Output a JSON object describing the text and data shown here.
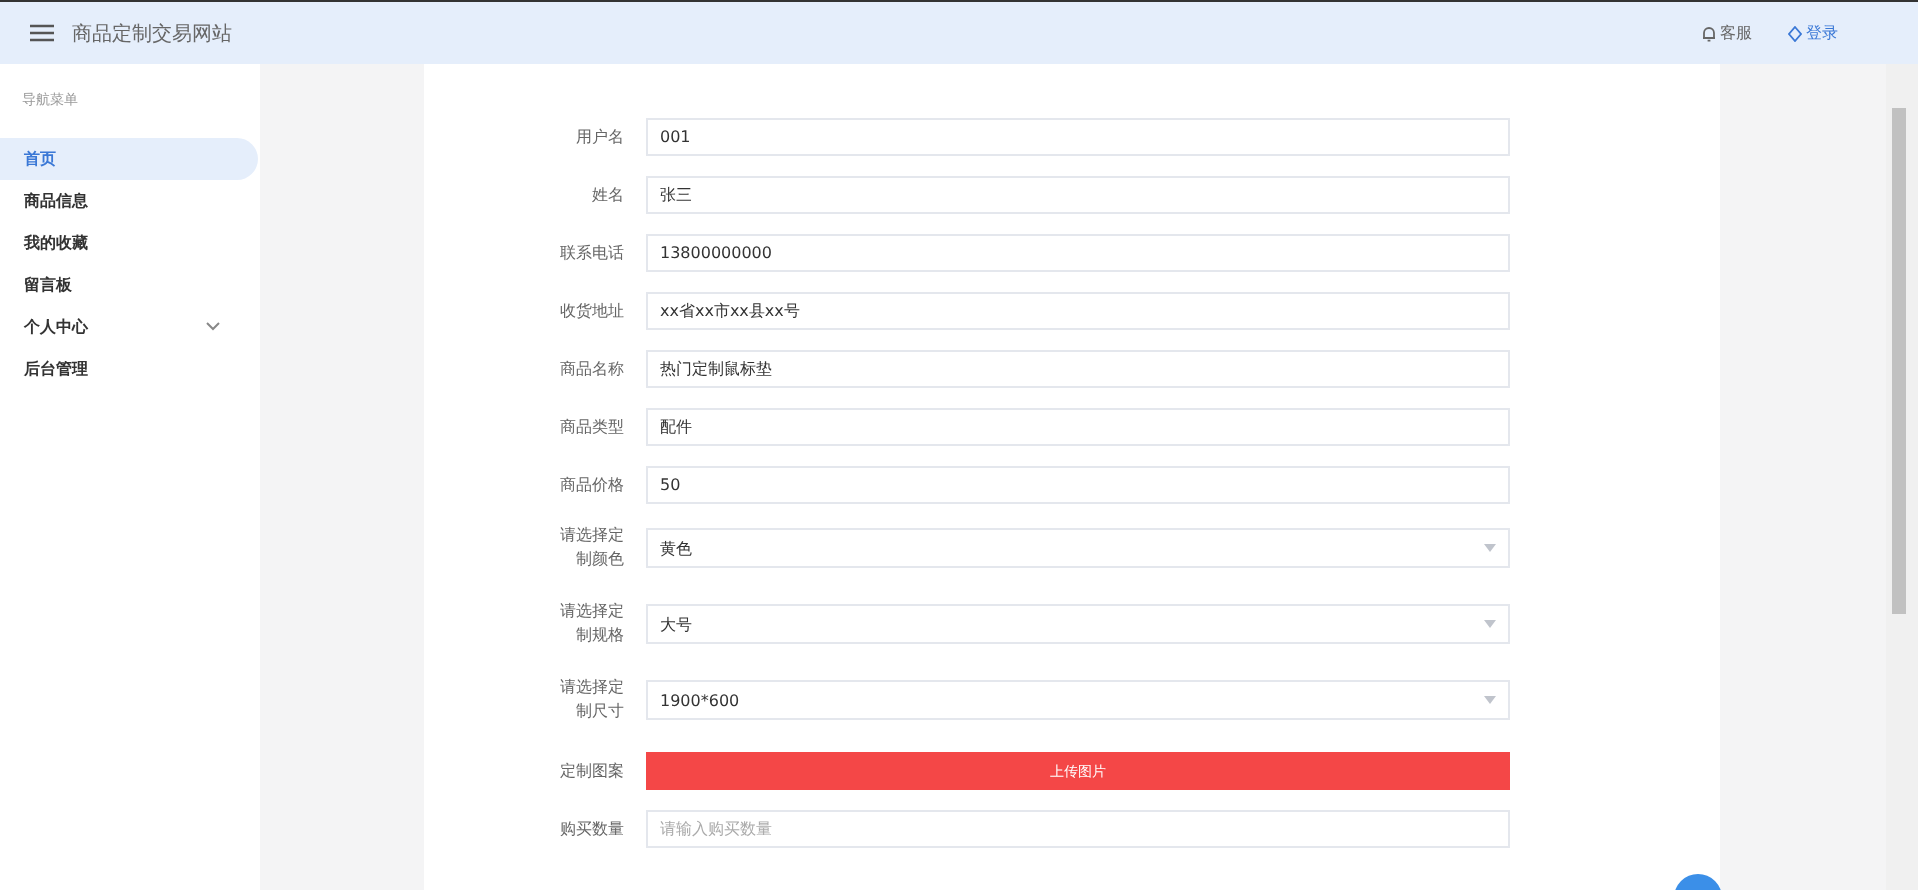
{
  "header": {
    "title": "商品定制交易网站",
    "links": [
      {
        "label": "客服",
        "kind": "service"
      },
      {
        "label": "登录",
        "kind": "login"
      }
    ]
  },
  "sidebar": {
    "heading": "导航菜单",
    "items": [
      {
        "label": "首页",
        "selected": true
      },
      {
        "label": "商品信息",
        "selected": false
      },
      {
        "label": "我的收藏",
        "selected": false
      },
      {
        "label": "留言板",
        "selected": false
      },
      {
        "label": "个人中心",
        "selected": false,
        "expanded": false
      },
      {
        "label": "后台管理",
        "selected": false
      }
    ]
  },
  "form": {
    "fields": [
      {
        "kind": "text",
        "label": "用户名",
        "value": "001"
      },
      {
        "kind": "text",
        "label": "姓名",
        "value": "张三"
      },
      {
        "kind": "text",
        "label": "联系电话",
        "value": "13800000000"
      },
      {
        "kind": "text",
        "label": "收货地址",
        "value": "xx省xx市xx县xx号"
      },
      {
        "kind": "text",
        "label": "商品名称",
        "value": "热门定制鼠标垫"
      },
      {
        "kind": "text",
        "label": "商品类型",
        "value": "配件"
      },
      {
        "kind": "text",
        "label": "商品价格",
        "value": "50"
      },
      {
        "kind": "select",
        "label": "请选择定制颜色",
        "value": "黄色"
      },
      {
        "kind": "select",
        "label": "请选择定制规格",
        "value": "大号"
      },
      {
        "kind": "select",
        "label": "请选择定制尺寸",
        "value": "1900*600"
      },
      {
        "kind": "upload",
        "label": "定制图案",
        "value": "上传图片"
      },
      {
        "kind": "text",
        "label": "购买数量",
        "placeholder": "请输入购买数量"
      }
    ]
  }
}
